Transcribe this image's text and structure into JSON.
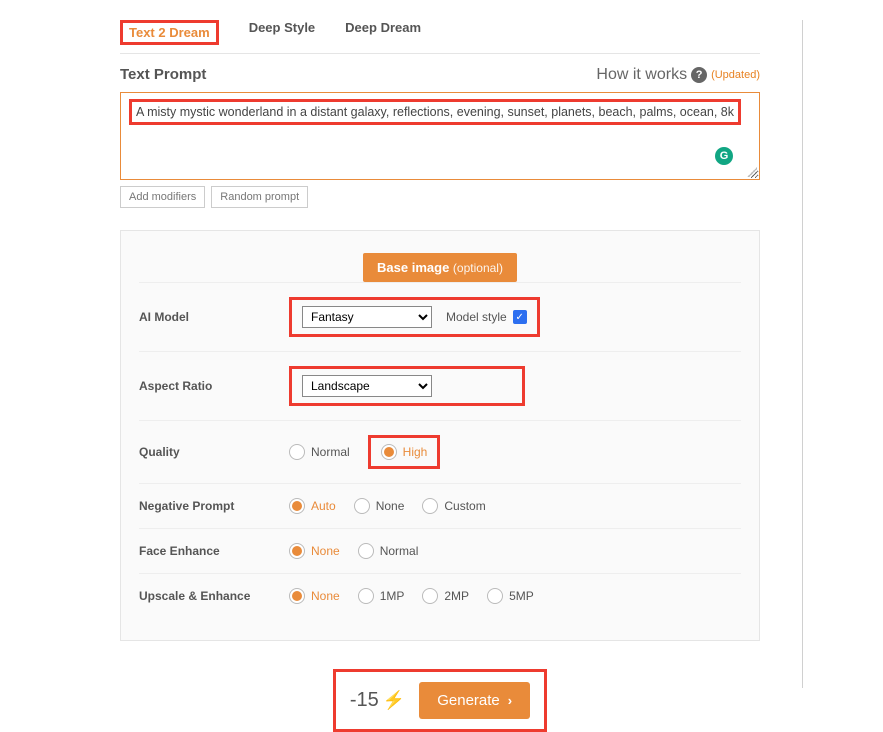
{
  "tabs": {
    "items": [
      {
        "label": "Text 2 Dream",
        "active": true
      },
      {
        "label": "Deep Style",
        "active": false
      },
      {
        "label": "Deep Dream",
        "active": false
      }
    ]
  },
  "prompt": {
    "heading": "Text Prompt",
    "how_label": "How it works",
    "updated_label": "(Updated)",
    "text": "A misty mystic wonderland in a distant galaxy, reflections, evening, sunset, planets, beach, palms, ocean, 8k",
    "add_modifiers_label": "Add modifiers",
    "random_label": "Random prompt"
  },
  "panel": {
    "base_image_label": "Base image",
    "base_image_optional": "(optional)",
    "rows": {
      "ai_model": {
        "label": "AI Model",
        "selected": "Fantasy",
        "model_style_label": "Model style",
        "model_style_checked": true
      },
      "aspect_ratio": {
        "label": "Aspect Ratio",
        "selected": "Landscape"
      },
      "quality": {
        "label": "Quality",
        "options": [
          "Normal",
          "High"
        ],
        "selected": "High"
      },
      "negative": {
        "label": "Negative Prompt",
        "options": [
          "Auto",
          "None",
          "Custom"
        ],
        "selected": "Auto"
      },
      "face": {
        "label": "Face Enhance",
        "options": [
          "None",
          "Normal"
        ],
        "selected": "None"
      },
      "upscale": {
        "label": "Upscale & Enhance",
        "options": [
          "None",
          "1MP",
          "2MP",
          "5MP"
        ],
        "selected": "None"
      }
    }
  },
  "generate": {
    "cost": "-15",
    "button_label": "Generate"
  },
  "colors": {
    "accent": "#e98b3a",
    "highlight": "#ee3b2f"
  }
}
